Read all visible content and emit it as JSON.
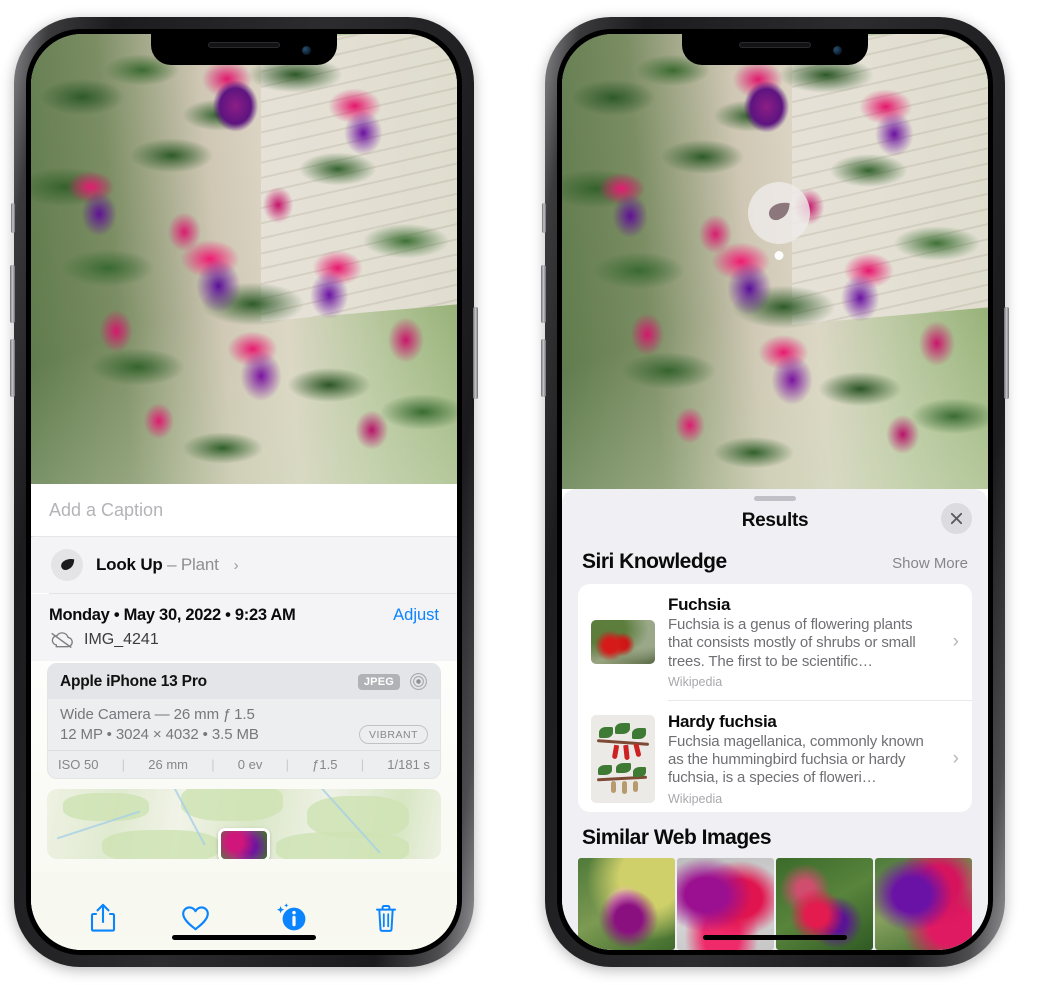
{
  "left_phone": {
    "photo": {
      "alt": "fuchsia-flowers-photo"
    },
    "caption_placeholder": "Add a Caption",
    "lookup": {
      "icon": "leaf-icon",
      "label": "Look Up",
      "dash": " – ",
      "subject": "Plant",
      "chevron": "›"
    },
    "date_line": "Monday • May 30, 2022 • 9:23 AM",
    "adjust_label": "Adjust",
    "file": {
      "icon": "cloud-slash-icon",
      "name": "IMG_4241"
    },
    "exif": {
      "device": "Apple iPhone 13 Pro",
      "format_badge": "JPEG",
      "lens_icon": "aperture-icon",
      "lens_line": "Wide Camera — 26 mm ƒ 1.5",
      "spec_line": "12 MP • 3024 × 4032 • 3.5 MB",
      "style_badge": "VIBRANT",
      "stats": [
        "ISO 50",
        "26 mm",
        "0 ev",
        "ƒ1.5",
        "1/181 s"
      ],
      "stat_separator": "|"
    },
    "map": {
      "name": "location-map-thumbnail"
    },
    "toolbar": [
      {
        "name": "share-button",
        "icon": "share-icon"
      },
      {
        "name": "favorite-button",
        "icon": "heart-icon"
      },
      {
        "name": "info-button",
        "icon": "info-sparkle-icon"
      },
      {
        "name": "delete-button",
        "icon": "trash-icon"
      }
    ]
  },
  "right_phone": {
    "photo": {
      "alt": "fuchsia-flowers-photo"
    },
    "lookup_badge": {
      "icon": "leaf-icon"
    },
    "sheet": {
      "title": "Results",
      "close_icon": "close-icon",
      "siri_knowledge": {
        "heading": "Siri Knowledge",
        "show_more": "Show More",
        "items": [
          {
            "title": "Fuchsia",
            "description": "Fuchsia is a genus of flowering plants that consists mostly of shrubs or small trees. The first to be scientific…",
            "source": "Wikipedia",
            "chevron": "›"
          },
          {
            "title": "Hardy fuchsia",
            "description": "Fuchsia magellanica, commonly known as the hummingbird fuchsia or hardy fuchsia, is a species of floweri…",
            "source": "Wikipedia",
            "chevron": "›"
          }
        ]
      },
      "similar_web_images": {
        "heading": "Similar Web Images",
        "items": [
          {
            "name": "web-image-1"
          },
          {
            "name": "web-image-2"
          },
          {
            "name": "web-image-3"
          },
          {
            "name": "web-image-4"
          }
        ]
      }
    }
  },
  "colors": {
    "accent_blue": "#0a84ff",
    "sheet_background": "#f0f0f4",
    "card_background": "#ffffff",
    "secondary_text": "#8e8e93"
  }
}
